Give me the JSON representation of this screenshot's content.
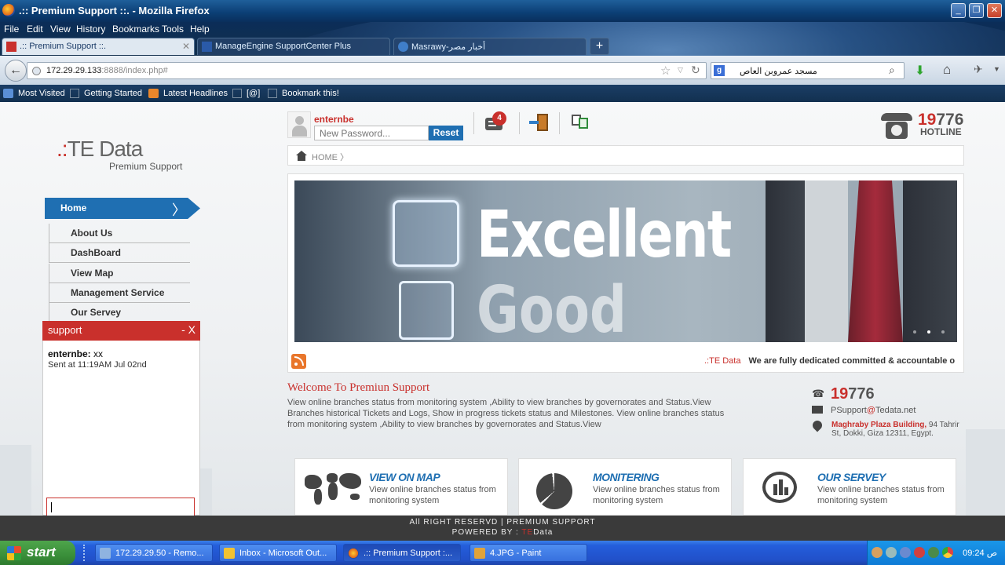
{
  "window": {
    "title": ".:: Premium Support ::. - Mozilla Firefox"
  },
  "menu": [
    "File",
    "Edit",
    "View",
    "History",
    "Bookmarks",
    "Tools",
    "Help"
  ],
  "tabs": [
    {
      "label": ".:: Premium Support ::.",
      "active": true
    },
    {
      "label": "ManageEngine SupportCenter Plus",
      "active": false
    },
    {
      "label": "Masrawy-أخبار مصر",
      "active": false
    }
  ],
  "address": {
    "host": "172.29.29.133",
    "rest": ":8888/index.php#"
  },
  "search": {
    "value": "مسجد عمروبن العاص"
  },
  "bookmarks": [
    "Most Visited",
    "Getting Started",
    "Latest Headlines",
    "[@]",
    "Bookmark this!"
  ],
  "logo": {
    "brand": "TE Data",
    "tagline": "Premium Support"
  },
  "sidebar": {
    "home": "Home",
    "items": [
      "About Us",
      "DashBoard",
      "View Map",
      "Management Service",
      "Our Servey"
    ]
  },
  "chat": {
    "title": "support",
    "controls": "- X",
    "sender": "enternbe:",
    "message": "xx",
    "sent": "Sent at 11:19AM Jul 02nd"
  },
  "user": {
    "name": "enternbe",
    "password_placeholder": "New Password...",
    "reset_label": "Reset",
    "notifications": "4"
  },
  "hotline": {
    "num_a": "19",
    "num_b": "776",
    "label": "HOTLINE"
  },
  "breadcrumb": "HOME 〉",
  "banner": {
    "line1": "Excellent",
    "line2": "Good"
  },
  "ticker": {
    "logo": ".:TE Data",
    "text": "We are fully dedicated committed & accountable o"
  },
  "welcome": {
    "title": "Welcome To Premiun Support",
    "body": "View online branches status from monitoring system ,Ability to view branches by governorates and Status.View Branches historical Tickets and Logs, Show in progress tickets status and Milestones. View online branches status from monitoring system ,Ability to view branches by governorates and Status.View"
  },
  "contact": {
    "num_a": "19",
    "num_b": "776",
    "email_a": "PSupport",
    "email_at": "@",
    "email_b": "Tedata.net",
    "addr_a": "Maghraby Plaza Building,",
    "addr_b": " 94 Tahrir St, Dokki, Giza 12311, Egypt."
  },
  "cards": [
    {
      "title": "VIEW ON MAP",
      "desc": "View online branches status from monitoring system"
    },
    {
      "title": "MONITERING",
      "desc": "View online branches status from monitoring system"
    },
    {
      "title": "OUR SERVEY",
      "desc": "View online branches status from monitoring system"
    }
  ],
  "footer": {
    "line1": "All RIGHT RESERVD | PREMIUM SUPPORT",
    "line2_a": "POWERED BY : ",
    "line2_b": "TE",
    "line2_c": "Data"
  },
  "taskbar": {
    "start": "start",
    "tasks": [
      "172.29.29.50 - Remo...",
      "Inbox - Microsoft Out...",
      ".:: Premium Support :...",
      "4.JPG - Paint"
    ],
    "clock": "09:24 ص"
  }
}
